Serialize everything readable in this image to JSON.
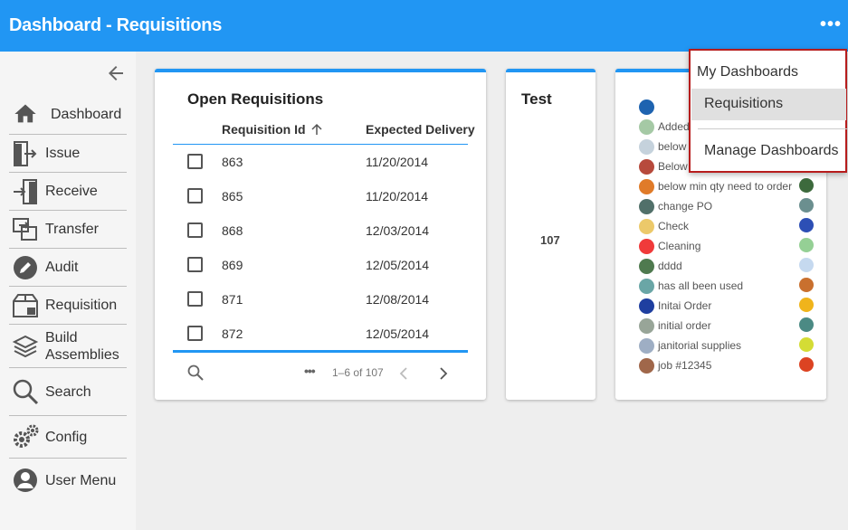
{
  "header": {
    "title": "Dashboard - Requisitions",
    "more_icon": "more-horizontal-icon",
    "color": "#2196f3"
  },
  "sidebar": {
    "collapse_icon": "arrow-left-icon",
    "items": [
      {
        "label": "Dashboard",
        "icon": "home-icon"
      },
      {
        "label": "Issue",
        "icon": "exit-door-icon"
      },
      {
        "label": "Receive",
        "icon": "enter-door-icon"
      },
      {
        "label": "Transfer",
        "icon": "transfer-icon"
      },
      {
        "label": "Audit",
        "icon": "pencil-circle-icon"
      },
      {
        "label": "Requisition",
        "icon": "box-icon"
      },
      {
        "label": "Build",
        "label2": "Assemblies",
        "icon": "layers-icon"
      },
      {
        "label": "Search",
        "icon": "search-icon"
      },
      {
        "label": "Config",
        "icon": "gears-icon"
      },
      {
        "label": "User Menu",
        "icon": "user-circle-icon"
      }
    ]
  },
  "requisitions_card": {
    "title": "Open Requisitions",
    "columns": [
      "Requisition Id",
      "Expected Delivery"
    ],
    "sort_icon": "arrow-up-icon",
    "rows": [
      {
        "id": "863",
        "date": "11/20/2014"
      },
      {
        "id": "865",
        "date": "11/20/2014"
      },
      {
        "id": "868",
        "date": "12/03/2014"
      },
      {
        "id": "869",
        "date": "12/05/2014"
      },
      {
        "id": "871",
        "date": "12/08/2014"
      },
      {
        "id": "872",
        "date": "12/05/2014"
      }
    ],
    "pagination": {
      "more": "•••",
      "range": "1–6 of 107"
    }
  },
  "test_card": {
    "title": "Test",
    "value": "107"
  },
  "legend_card": {
    "items": [
      {
        "label": "",
        "color": "#1e63b0"
      },
      {
        "label": "Added",
        "color": "#a5c9a5"
      },
      {
        "label": "below",
        "color": "#c5d2dc"
      },
      {
        "label": "Below",
        "color": "#b74a3c"
      },
      {
        "label": "below min qty need to order",
        "color": "#e07b29"
      },
      {
        "label": "change PO",
        "color": "#51706a"
      },
      {
        "label": "Check",
        "color": "#ecc96a"
      },
      {
        "label": "Cleaning",
        "color": "#f03a3a"
      },
      {
        "label": "dddd",
        "color": "#4f7a4f"
      },
      {
        "label": "has all been used",
        "color": "#6aa6a6"
      },
      {
        "label": "Initai Order",
        "color": "#1f3fa0"
      },
      {
        "label": "initial order",
        "color": "#98a598"
      },
      {
        "label": "janitorial supplies",
        "color": "#9eaec4"
      },
      {
        "label": "job #12345",
        "color": "#a0674a"
      }
    ],
    "second_column_colors": [
      "#3d6a3d",
      "#6b8f8f",
      "#2d4fb5",
      "#95d095",
      "#c5d9ef",
      "#c9702e",
      "#f0b41b",
      "#4b8a84",
      "#d4dc35",
      "#dc4322"
    ]
  },
  "dropdown": {
    "items": [
      {
        "label": "My Dashboards"
      },
      {
        "label": "Requisitions"
      },
      {
        "label": "Manage Dashboards"
      }
    ]
  }
}
